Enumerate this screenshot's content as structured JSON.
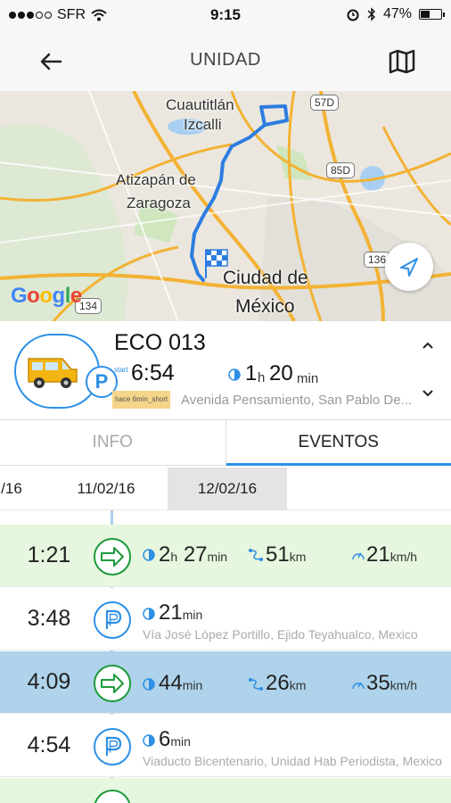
{
  "status_bar": {
    "carrier": "SFR",
    "time": "9:15",
    "battery": "47%",
    "battery_level": 0.47
  },
  "header": {
    "title": "UNIDAD"
  },
  "map": {
    "labels": {
      "cuautitlan": "Cuautitlán",
      "izcalli": "Izcalli",
      "atizapan": "Atizapán de",
      "zaragoza": "Zaragoza",
      "ciudad": "Ciudad de",
      "mexico": "México"
    },
    "shields": {
      "s57d": "57D",
      "s85d": "85D",
      "s136": "136",
      "s134": "134"
    },
    "google_logo": "Google",
    "colors": {
      "route": "#2d7de0",
      "highway": "#f3b233",
      "water": "#a8cff2",
      "park": "#cfe6bf"
    }
  },
  "unit": {
    "name": "ECO 013",
    "start_label": "start",
    "start_time": "6:54",
    "duration_h": "1",
    "duration_h_unit": "h",
    "duration_m": "20",
    "duration_m_unit": "min",
    "ago_badge": "hace 6min_short",
    "address": "Avenida Pensamiento, San Pablo De..."
  },
  "tabs": [
    {
      "label": "INFO"
    },
    {
      "label": "EVENTOS"
    }
  ],
  "dates": [
    "/16",
    "11/02/16",
    "12/02/16"
  ],
  "events": [
    {
      "type": "moving",
      "time": "1:21",
      "duration_h": "2",
      "h_unit": "h",
      "duration_m": "27",
      "m_unit": "min",
      "distance": "51",
      "distance_unit": "km",
      "speed": "21",
      "speed_unit": "km/h"
    },
    {
      "type": "parked",
      "time": "3:48",
      "duration_m": "21",
      "m_unit": "min",
      "address": "Vía José López Portillo, Ejido Teyahualco, Mexico"
    },
    {
      "type": "moving",
      "time": "4:09",
      "duration_m": "44",
      "m_unit": "min",
      "distance": "26",
      "distance_unit": "km",
      "speed": "35",
      "speed_unit": "km/h"
    },
    {
      "type": "parked",
      "time": "4:54",
      "duration_m": "6",
      "m_unit": "min",
      "address": "Viaducto Bicentenario, Unidad Hab Periodista, Mexico"
    }
  ],
  "colors": {
    "accent": "#2d8fe6",
    "moving_green": "#1f9a3c",
    "moving_row": "#e6f6df",
    "selected_row": "#aed3ea"
  }
}
